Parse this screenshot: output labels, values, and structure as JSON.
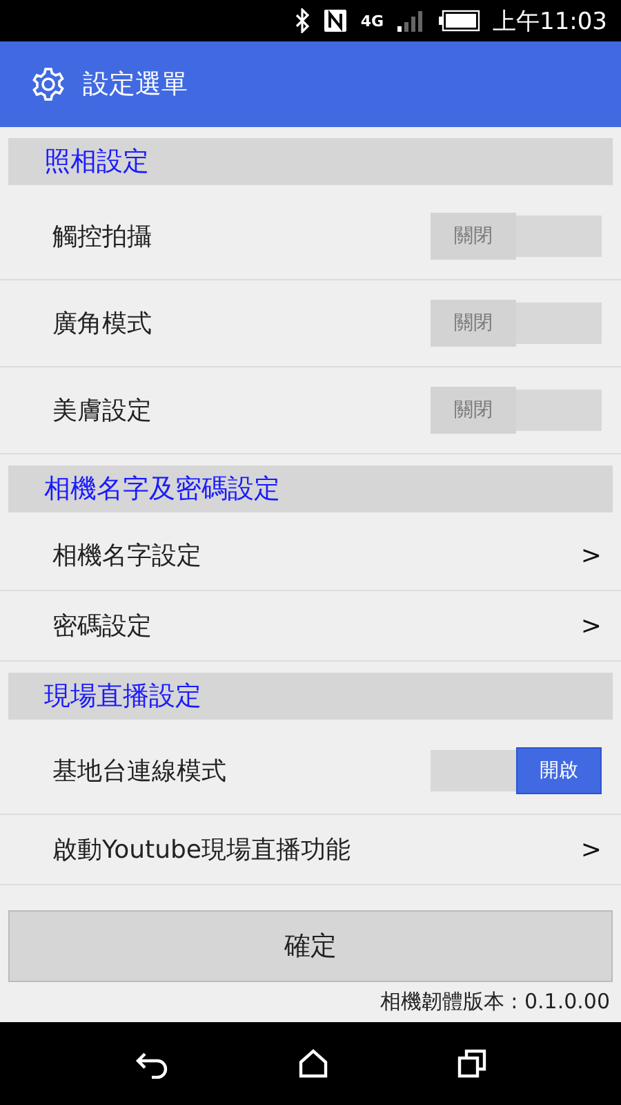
{
  "status_bar": {
    "network": "4G",
    "time": "上午11:03"
  },
  "header": {
    "title": "設定選單"
  },
  "sections": [
    {
      "title": "照相設定",
      "items": [
        {
          "kind": "toggle",
          "label": "觸控拍攝",
          "on": false,
          "state_label": "關閉"
        },
        {
          "kind": "toggle",
          "label": "廣角模式",
          "on": false,
          "state_label": "關閉"
        },
        {
          "kind": "toggle",
          "label": "美膚設定",
          "on": false,
          "state_label": "關閉"
        }
      ]
    },
    {
      "title": "相機名字及密碼設定",
      "items": [
        {
          "kind": "link",
          "label": "相機名字設定",
          "chevron": ">"
        },
        {
          "kind": "link",
          "label": "密碼設定",
          "chevron": ">"
        }
      ]
    },
    {
      "title": "現場直播設定",
      "items": [
        {
          "kind": "toggle",
          "label": "基地台連線模式",
          "on": true,
          "state_label": "開啟"
        },
        {
          "kind": "link",
          "label": "啟動Youtube現場直播功能",
          "chevron": ">"
        }
      ]
    }
  ],
  "confirm_button": "確定",
  "version": "相機韌體版本 : 0.1.0.00"
}
